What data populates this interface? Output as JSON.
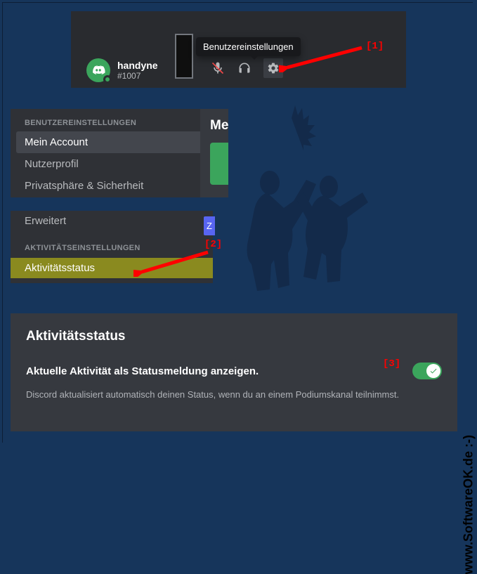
{
  "panel1": {
    "username": "handyne",
    "discriminator": "#1007",
    "tooltip": "Benutzereinstellungen"
  },
  "panel2": {
    "category": "BENUTZEREINSTELLUNGEN",
    "items": [
      "Mein Account",
      "Nutzerprofil",
      "Privatsphäre & Sicherheit"
    ],
    "right_title": "Me"
  },
  "panel3": {
    "item_advanced": "Erweitert",
    "category": "AKTIVITÄTSEINSTELLUNGEN",
    "item_activity": "Aktivitätsstatus",
    "button_fragment": "Z"
  },
  "panel4": {
    "heading": "Aktivitätsstatus",
    "toggle_label": "Aktuelle Aktivität als Statusmeldung anzeigen.",
    "toggle_on": true,
    "description": "Discord aktualisiert automatisch deinen Status, wenn du an einem Podiumskanal teilnimmst."
  },
  "annotations": {
    "a1": "[1]",
    "a2": "[2]",
    "a3": "[3]"
  },
  "watermark": "www.SoftwareOK.de :-)",
  "colors": {
    "bg": "#16355b",
    "dark1": "#292b2f",
    "dark2": "#2f3136",
    "dark3": "#36393f",
    "green": "#3ba55c",
    "blurple": "#5865f2",
    "highlight": "#8a8a1f",
    "red": "#ff0000"
  }
}
